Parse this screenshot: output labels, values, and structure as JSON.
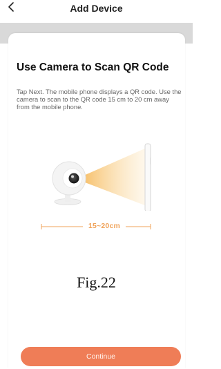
{
  "header": {
    "title": "Add Device",
    "back_icon": "chevron-left-icon"
  },
  "main": {
    "heading": "Use Camera to Scan QR Code",
    "description": "Tap Next. The mobile phone displays a QR code. Use the camera to scan to the QR code 15 cm to 20 cm away from the mobile phone.",
    "illustration": {
      "icons": [
        "camera-icon",
        "phone-icon"
      ],
      "beam_color": "#f5b24a"
    },
    "distance_label": "15~20cm",
    "caption": "Fig.22"
  },
  "footer": {
    "button_label": "Continue",
    "button_color": "#ef7d57"
  }
}
